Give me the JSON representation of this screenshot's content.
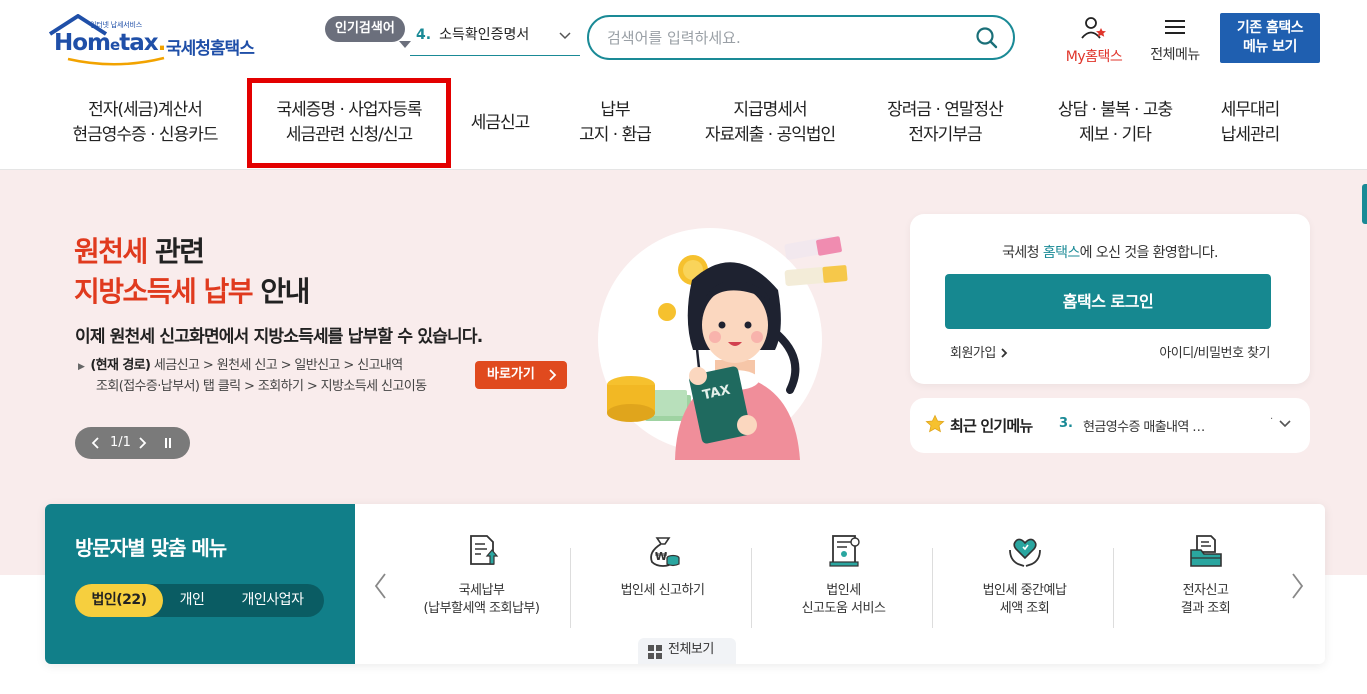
{
  "header": {
    "logo_small_text": "인터넷 납세서비스",
    "logo_word_home": "Hom",
    "logo_word_e": "e",
    "logo_word_tax": "tax",
    "logo_word_dot": ".",
    "logo_kor": "국세청홈택스",
    "popular_badge": "인기검색어",
    "popular_rank": "4.",
    "popular_keyword": "소득확인증명서",
    "search_placeholder": "검색어를 입력하세요.",
    "my_hometax_label": "My홈택스",
    "all_menu_label": "전체메뉴",
    "old_hometax_button": "기존 홈택스\n메뉴 보기"
  },
  "nav": {
    "items": [
      {
        "label": "전자(세금)계산서\n현금영수증 · 신용카드",
        "active": false
      },
      {
        "label": "국세증명 · 사업자등록\n세금관련 신청/신고",
        "active": true
      },
      {
        "label": "세금신고",
        "active": false
      },
      {
        "label": "납부\n고지 · 환급",
        "active": false
      },
      {
        "label": "지급명세서\n자료제출 · 공익법인",
        "active": false
      },
      {
        "label": "장려금 · 연말정산\n전자기부금",
        "active": false
      },
      {
        "label": "상담 · 불복 · 고충\n제보 · 기타",
        "active": false
      },
      {
        "label": "세무대리\n납세관리",
        "active": false
      }
    ]
  },
  "hero": {
    "title_red_1": "원천세",
    "title_black_1": " 관련",
    "title_red_2": "지방소득세 납부",
    "title_black_2": " 안내",
    "subtitle": "이제 원천세 신고화면에서 지방소득세를 납부할 수 있습니다.",
    "path_label": "(현재 경로)",
    "path_line1": " 세금신고 > 원천세 신고 > 일반신고 > 신고내역",
    "path_line2": "조회(접수증·납부서) 탭 클릭 > 조회하기 > 지방소득세 신고이동",
    "goto_button": "바로가기",
    "slider_indicator": "1/1",
    "illustration_text": "TAX"
  },
  "welcome": {
    "text_prefix": "국세청 ",
    "text_brand": "홈택스",
    "text_suffix": "에 오신 것을 환영합니다.",
    "login_button": "홈택스 로그인",
    "join_link": "회원가입",
    "find_link": "아이디/비밀번호 찾기"
  },
  "recent": {
    "label": "최근 인기메뉴",
    "rank": "3.",
    "item": "현금영수증 매출내역 …",
    "more": "·"
  },
  "visitor_menu": {
    "title": "방문자별 맞춤 메뉴",
    "tabs": [
      {
        "label": "법인(22)",
        "active": true
      },
      {
        "label": "개인",
        "active": false
      },
      {
        "label": "개인사업자",
        "active": false
      }
    ],
    "items": [
      {
        "icon": "tax-payment-document-icon",
        "label": "국세납부\n(납부할세액 조회납부)"
      },
      {
        "icon": "money-bag-icon",
        "label": "법인세 신고하기"
      },
      {
        "icon": "document-guide-icon",
        "label": "법인세\n신고도움 서비스"
      },
      {
        "icon": "heart-hands-icon",
        "label": "법인세 중간예납\n세액 조회"
      },
      {
        "icon": "folder-document-icon",
        "label": "전자신고\n결과 조회"
      }
    ],
    "all_view_label": "전체보기"
  },
  "colors": {
    "brand_blue": "#1f4fa8",
    "teal": "#168890",
    "highlight_red": "#e30000",
    "hero_bg": "#f9ecec",
    "accent_orange": "#e04a1e",
    "tab_yellow": "#f6cf3e"
  }
}
